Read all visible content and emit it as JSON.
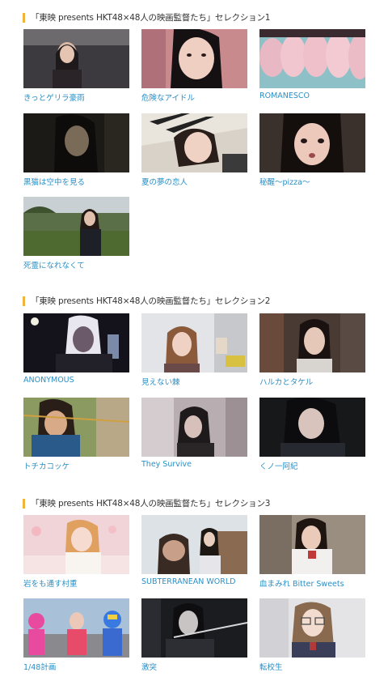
{
  "sections": [
    {
      "title": "「東映 presents HKT48×48人の映画監督たち」セレクション1",
      "items": [
        {
          "title": "きっとゲリラ豪雨"
        },
        {
          "title": "危険なアイドル"
        },
        {
          "title": "ROMANESCO"
        },
        {
          "title": "黒猫は空中を見る"
        },
        {
          "title": "夏の夢の恋人"
        },
        {
          "title": "秘醒〜pizza〜"
        },
        {
          "title": "死霊になれなくて"
        }
      ]
    },
    {
      "title": "「東映 presents HKT48×48人の映画監督たち」セレクション2",
      "items": [
        {
          "title": "ANONYMOUS"
        },
        {
          "title": "見えない棘"
        },
        {
          "title": "ハルカとタケル"
        },
        {
          "title": "トチカコッケ"
        },
        {
          "title": "They Survive"
        },
        {
          "title": "くノ一阿紀"
        }
      ]
    },
    {
      "title": "「東映 presents HKT48×48人の映画監督たち」セレクション3",
      "items": [
        {
          "title": "岩をも通す村重"
        },
        {
          "title": "SUBTERRANEAN WORLD"
        },
        {
          "title": "血まみれ Bitter Sweets"
        },
        {
          "title": "1/48計画"
        },
        {
          "title": "激突"
        },
        {
          "title": "転校生"
        }
      ]
    }
  ],
  "colors": {
    "accent_bar": "#f0b43a",
    "link": "#2a8fc6",
    "heading_text": "#333333"
  }
}
